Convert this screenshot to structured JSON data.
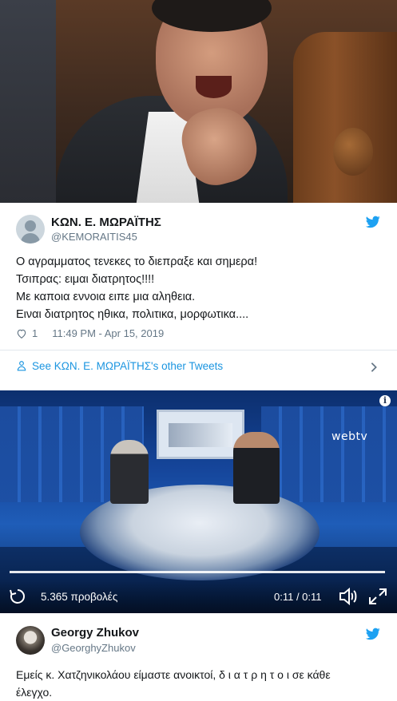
{
  "tweet1": {
    "name": "ΚΩΝ. Ε. ΜΩΡΑΪΤΗΣ",
    "handle": "@KEMORAITIS45",
    "text": "Ο αγραμματος τενεκες το διεπραξε και σημερα!\nΤσιπρας: ειμαι διατρητος!!!!\nΜε καποια εννοια ειπε μια αληθεια.\n Ειναι διατρητος ηθικα, πολιτικα, μορφωτικα....",
    "likes": "1",
    "timestamp": "11:49 PM - Apr 15, 2019",
    "see_other": "See ΚΩΝ. Ε. ΜΩΡΑΪΤΗΣ's other Tweets"
  },
  "video": {
    "channel_logo": "webtv",
    "views": "5.365 προβολές",
    "time": "0:11 / 0:11",
    "progress_fraction": 1.0
  },
  "tweet2": {
    "name": "Georgy Zhukov",
    "handle": "@GeorghyZhukov",
    "text": "Εμείς κ. Χατζηνικολάου είμαστε ανοικτοί, δ ι α τ ρ η τ ο ι σε κάθε\nέλεγχο."
  },
  "colors": {
    "twitter_blue": "#1da1f2",
    "link_blue": "#1b95e0",
    "secondary_text": "#657786"
  }
}
